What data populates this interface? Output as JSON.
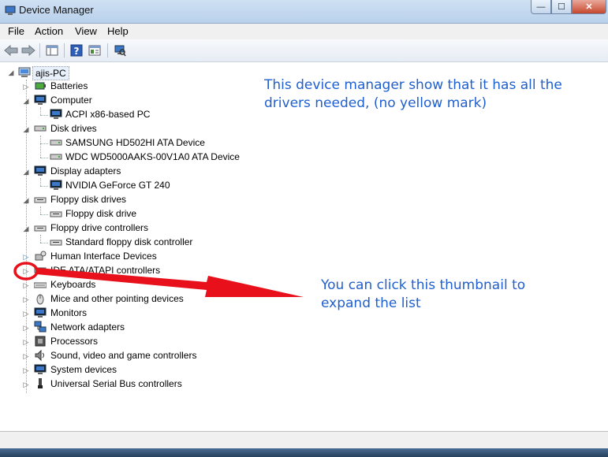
{
  "window": {
    "title": "Device Manager",
    "controls": {
      "minimize": "—",
      "maximize": "☐",
      "close": "✕"
    }
  },
  "menu": [
    "File",
    "Action",
    "View",
    "Help"
  ],
  "toolbar": {
    "buttons": [
      "back-icon",
      "forward-icon",
      "show-hide-console-tree-icon",
      "help-icon",
      "properties-icon",
      "scan-hardware-icon"
    ]
  },
  "tree": {
    "root": "ajis-PC",
    "items": [
      {
        "label": "Batteries",
        "expanded": false,
        "icon": "battery-icon"
      },
      {
        "label": "Computer",
        "expanded": true,
        "icon": "computer-icon",
        "children": [
          "ACPI x86-based PC"
        ]
      },
      {
        "label": "Disk drives",
        "expanded": true,
        "icon": "disk-drive-icon",
        "children": [
          "SAMSUNG HD502HI ATA Device",
          "WDC WD5000AAKS-00V1A0 ATA Device"
        ]
      },
      {
        "label": "Display adapters",
        "expanded": true,
        "icon": "monitor-icon",
        "children": [
          "NVIDIA GeForce GT 240"
        ]
      },
      {
        "label": "Floppy disk drives",
        "expanded": true,
        "icon": "floppy-icon",
        "children": [
          "Floppy disk drive"
        ]
      },
      {
        "label": "Floppy drive controllers",
        "expanded": true,
        "icon": "floppy-controller-icon",
        "children": [
          "Standard floppy disk controller"
        ]
      },
      {
        "label": "Human Interface Devices",
        "expanded": false,
        "icon": "hid-icon"
      },
      {
        "label": "IDE ATA/ATAPI controllers",
        "expanded": false,
        "icon": "ide-icon"
      },
      {
        "label": "Keyboards",
        "expanded": false,
        "icon": "keyboard-icon"
      },
      {
        "label": "Mice and other pointing devices",
        "expanded": false,
        "icon": "mouse-icon"
      },
      {
        "label": "Monitors",
        "expanded": false,
        "icon": "monitor-icon"
      },
      {
        "label": "Network adapters",
        "expanded": false,
        "icon": "network-icon"
      },
      {
        "label": "Processors",
        "expanded": false,
        "icon": "processor-icon"
      },
      {
        "label": "Sound, video and game controllers",
        "expanded": false,
        "icon": "speaker-icon"
      },
      {
        "label": "System devices",
        "expanded": false,
        "icon": "system-icon"
      },
      {
        "label": "Universal Serial Bus controllers",
        "expanded": false,
        "icon": "usb-icon"
      }
    ]
  },
  "annotations": {
    "note1_line1": "This device manager show that it has all the",
    "note1_line2": "drivers needed, (no yellow mark)",
    "note2_line1": "You can click this thumbnail to",
    "note2_line2": "expand the list",
    "color": "#1f5fd0",
    "arrow_color": "#e8101a"
  }
}
